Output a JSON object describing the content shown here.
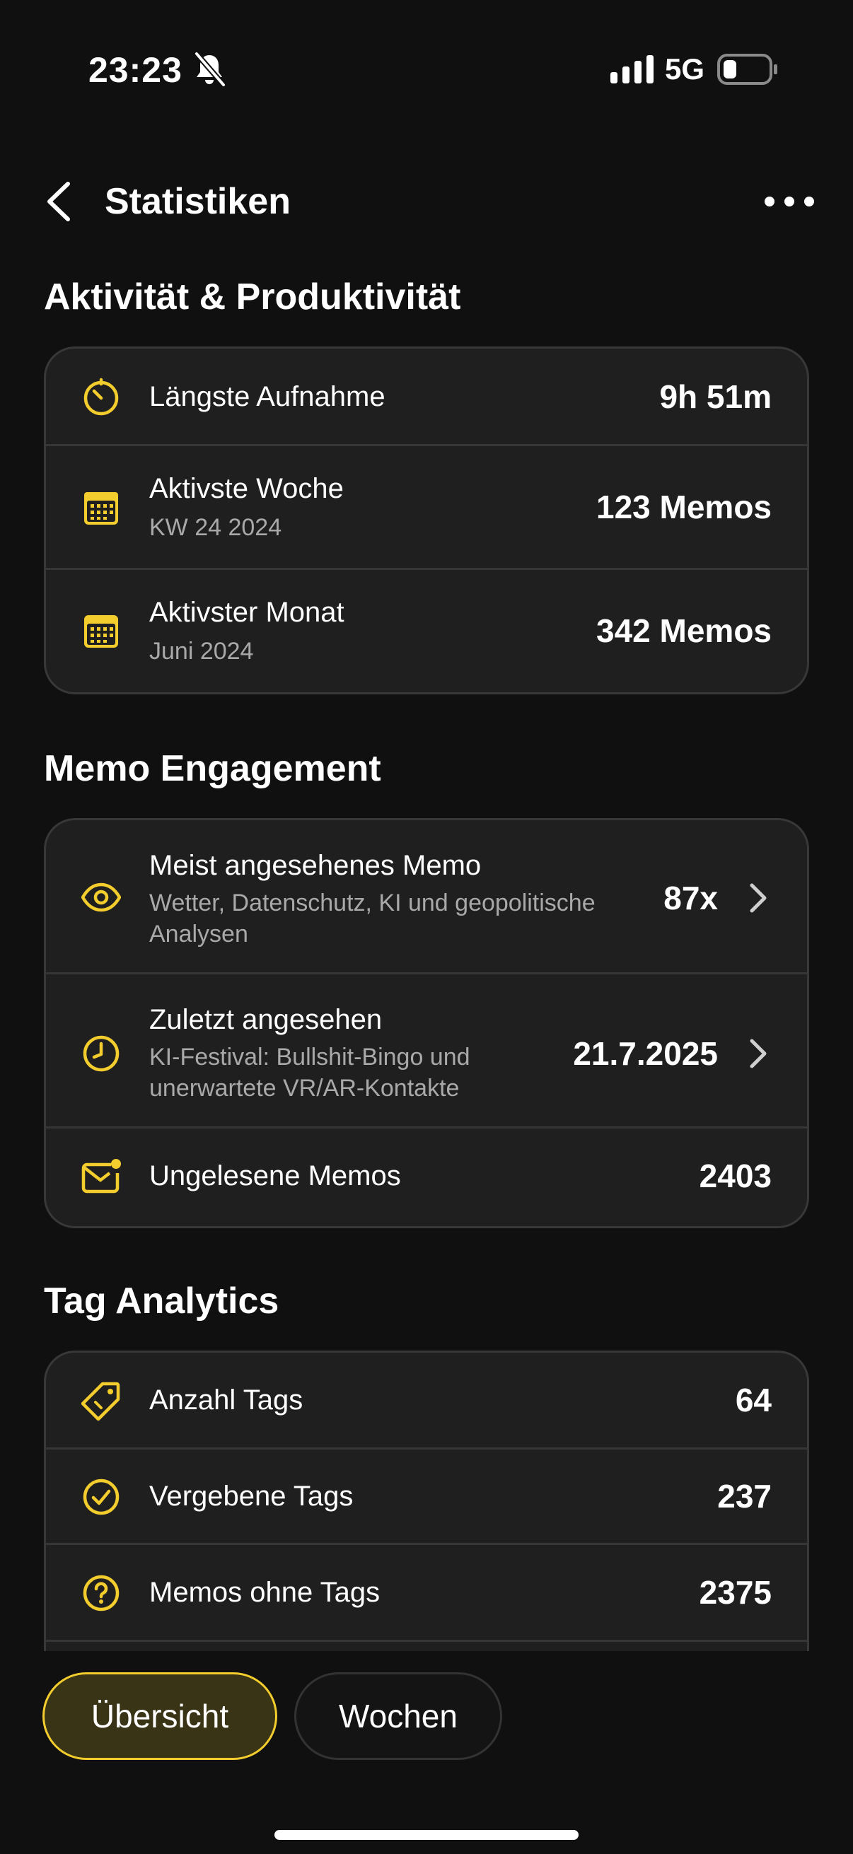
{
  "status_bar": {
    "time": "23:23",
    "network": "5G"
  },
  "nav": {
    "title": "Statistiken"
  },
  "sections": {
    "activity": {
      "title": "Aktivität & Produktivität",
      "rows": [
        {
          "title": "Längste Aufnahme",
          "value": "9h 51m"
        },
        {
          "title": "Aktivste Woche",
          "subtitle": "KW 24 2024",
          "value": "123 Memos"
        },
        {
          "title": "Aktivster Monat",
          "subtitle": "Juni 2024",
          "value": "342 Memos"
        }
      ]
    },
    "engagement": {
      "title": "Memo Engagement",
      "rows": [
        {
          "title": "Meist angesehenes Memo",
          "subtitle_1": "Wetter, Datenschutz, KI und geopolitische",
          "subtitle_2": "Analysen",
          "value": "87x"
        },
        {
          "title": "Zuletzt angesehen",
          "subtitle_1": "KI-Festival: Bullshit-Bingo und",
          "subtitle_2": "unerwartete VR/AR-Kontakte",
          "value": "21.7.2025"
        },
        {
          "title": "Ungelesene Memos",
          "value": "2403"
        }
      ]
    },
    "tags": {
      "title": "Tag Analytics",
      "rows": [
        {
          "title": "Anzahl Tags",
          "value": "64"
        },
        {
          "title": "Vergebene Tags",
          "value": "237"
        },
        {
          "title": "Memos ohne Tags",
          "value": "2375"
        }
      ]
    }
  },
  "tabs": [
    {
      "label": "Übersicht",
      "active": true
    },
    {
      "label": "Wochen",
      "active": false
    }
  ],
  "colors": {
    "accent": "#f3cd2d",
    "background": "#101010",
    "card": "#1f1f1f",
    "subtext": "#a9a9a9"
  },
  "icons": {
    "activity": [
      "timer-icon",
      "calendar-icon",
      "calendar-icon"
    ],
    "engagement": [
      "eye-icon",
      "clock-icon",
      "unread-mail-icon"
    ],
    "tags": [
      "tag-icon",
      "check-circle-icon",
      "question-circle-icon"
    ]
  }
}
